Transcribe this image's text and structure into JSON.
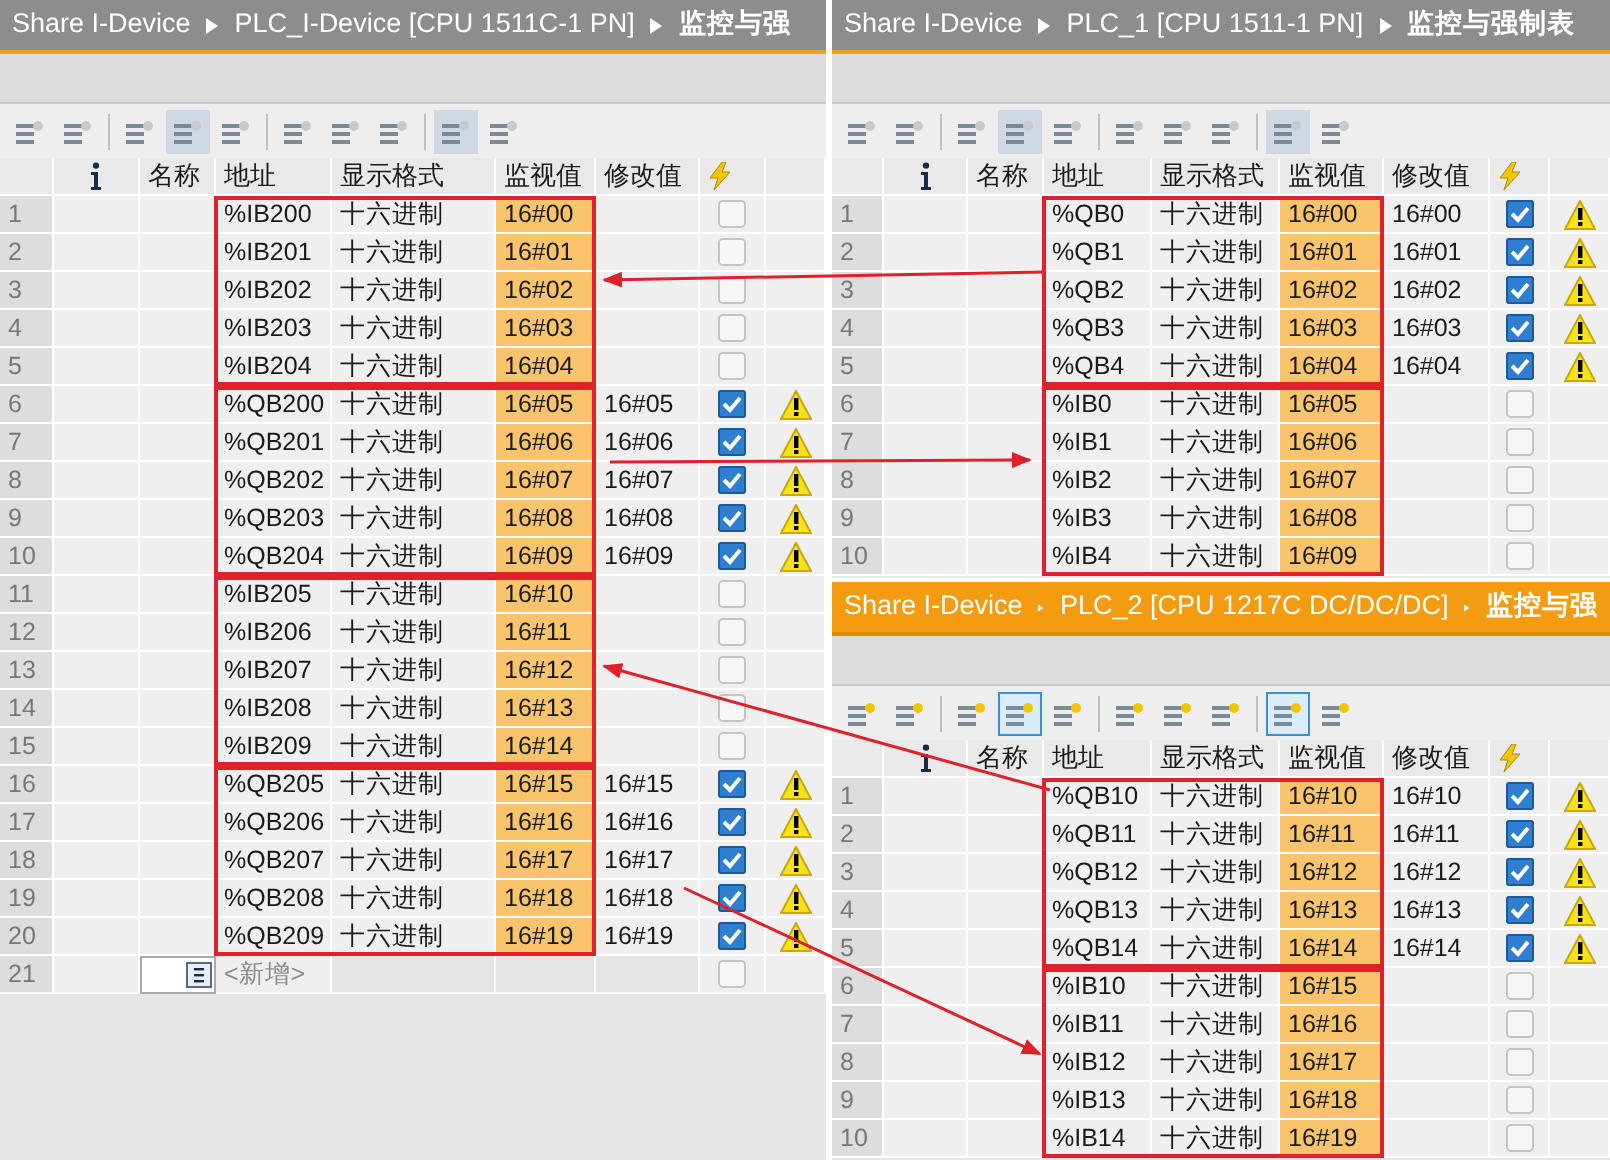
{
  "panels": [
    {
      "breadcrumb": [
        "Share I-Device",
        "PLC_I-Device [CPU 1511C-1 PN]",
        "监控与强"
      ],
      "active": false,
      "columns": [
        "名称",
        "地址",
        "显示格式",
        "监视值",
        "修改值"
      ],
      "groups": [
        {
          "rows": [
            {
              "number": "1",
              "address": "%IB200",
              "format": "十六进制",
              "monitor": "16#00",
              "checked": false,
              "warning": false
            },
            {
              "number": "2",
              "address": "%IB201",
              "format": "十六进制",
              "monitor": "16#01",
              "checked": false,
              "warning": false
            },
            {
              "number": "3",
              "address": "%IB202",
              "format": "十六进制",
              "monitor": "16#02",
              "checked": false,
              "warning": false
            },
            {
              "number": "4",
              "address": "%IB203",
              "format": "十六进制",
              "monitor": "16#03",
              "checked": false,
              "warning": false
            },
            {
              "number": "5",
              "address": "%IB204",
              "format": "十六进制",
              "monitor": "16#04",
              "checked": false,
              "warning": false
            }
          ]
        },
        {
          "rows": [
            {
              "number": "6",
              "address": "%QB200",
              "format": "十六进制",
              "monitor": "16#05",
              "modify": "16#05",
              "checked": true,
              "warning": true
            },
            {
              "number": "7",
              "address": "%QB201",
              "format": "十六进制",
              "monitor": "16#06",
              "modify": "16#06",
              "checked": true,
              "warning": true
            },
            {
              "number": "8",
              "address": "%QB202",
              "format": "十六进制",
              "monitor": "16#07",
              "modify": "16#07",
              "checked": true,
              "warning": true
            },
            {
              "number": "9",
              "address": "%QB203",
              "format": "十六进制",
              "monitor": "16#08",
              "modify": "16#08",
              "checked": true,
              "warning": true
            },
            {
              "number": "10",
              "address": "%QB204",
              "format": "十六进制",
              "monitor": "16#09",
              "modify": "16#09",
              "checked": true,
              "warning": true
            }
          ]
        },
        {
          "rows": [
            {
              "number": "11",
              "address": "%IB205",
              "format": "十六进制",
              "monitor": "16#10",
              "checked": false,
              "warning": false
            },
            {
              "number": "12",
              "address": "%IB206",
              "format": "十六进制",
              "monitor": "16#11",
              "checked": false,
              "warning": false
            },
            {
              "number": "13",
              "address": "%IB207",
              "format": "十六进制",
              "monitor": "16#12",
              "checked": false,
              "warning": false
            },
            {
              "number": "14",
              "address": "%IB208",
              "format": "十六进制",
              "monitor": "16#13",
              "checked": false,
              "warning": false
            },
            {
              "number": "15",
              "address": "%IB209",
              "format": "十六进制",
              "monitor": "16#14",
              "checked": false,
              "warning": false
            }
          ]
        },
        {
          "rows": [
            {
              "number": "16",
              "address": "%QB205",
              "format": "十六进制",
              "monitor": "16#15",
              "modify": "16#15",
              "checked": true,
              "warning": true
            },
            {
              "number": "17",
              "address": "%QB206",
              "format": "十六进制",
              "monitor": "16#16",
              "modify": "16#16",
              "checked": true,
              "warning": true
            },
            {
              "number": "18",
              "address": "%QB207",
              "format": "十六进制",
              "monitor": "16#17",
              "modify": "16#17",
              "checked": true,
              "warning": true
            },
            {
              "number": "19",
              "address": "%QB208",
              "format": "十六进制",
              "monitor": "16#18",
              "modify": "16#18",
              "checked": true,
              "warning": true
            },
            {
              "number": "20",
              "address": "%QB209",
              "format": "十六进制",
              "monitor": "16#19",
              "modify": "16#19",
              "checked": true,
              "warning": true
            }
          ]
        }
      ],
      "new_row": {
        "number": "21",
        "text": "<新增>",
        "checked": false
      }
    },
    {
      "breadcrumb": [
        "Share I-Device",
        "PLC_1 [CPU 1511-1 PN]",
        "监控与强制表"
      ],
      "active": false,
      "columns": [
        "名称",
        "地址",
        "显示格式",
        "监视值",
        "修改值"
      ],
      "groups": [
        {
          "rows": [
            {
              "number": "1",
              "address": "%QB0",
              "format": "十六进制",
              "monitor": "16#00",
              "modify": "16#00",
              "checked": true,
              "warning": true
            },
            {
              "number": "2",
              "address": "%QB1",
              "format": "十六进制",
              "monitor": "16#01",
              "modify": "16#01",
              "checked": true,
              "warning": true
            },
            {
              "number": "3",
              "address": "%QB2",
              "format": "十六进制",
              "monitor": "16#02",
              "modify": "16#02",
              "checked": true,
              "warning": true
            },
            {
              "number": "4",
              "address": "%QB3",
              "format": "十六进制",
              "monitor": "16#03",
              "modify": "16#03",
              "checked": true,
              "warning": true
            },
            {
              "number": "5",
              "address": "%QB4",
              "format": "十六进制",
              "monitor": "16#04",
              "modify": "16#04",
              "checked": true,
              "warning": true
            }
          ]
        },
        {
          "rows": [
            {
              "number": "6",
              "address": "%IB0",
              "format": "十六进制",
              "monitor": "16#05",
              "checked": false,
              "warning": false
            },
            {
              "number": "7",
              "address": "%IB1",
              "format": "十六进制",
              "monitor": "16#06",
              "checked": false,
              "warning": false
            },
            {
              "number": "8",
              "address": "%IB2",
              "format": "十六进制",
              "monitor": "16#07",
              "checked": false,
              "warning": false
            },
            {
              "number": "9",
              "address": "%IB3",
              "format": "十六进制",
              "monitor": "16#08",
              "checked": false,
              "warning": false
            },
            {
              "number": "10",
              "address": "%IB4",
              "format": "十六进制",
              "monitor": "16#09",
              "checked": false,
              "warning": false
            }
          ]
        }
      ]
    },
    {
      "breadcrumb": [
        "Share I-Device",
        "PLC_2 [CPU 1217C DC/DC/DC]",
        "监控与强"
      ],
      "active": true,
      "columns": [
        "名称",
        "地址",
        "显示格式",
        "监视值",
        "修改值"
      ],
      "groups": [
        {
          "rows": [
            {
              "number": "1",
              "address": "%QB10",
              "format": "十六进制",
              "monitor": "16#10",
              "modify": "16#10",
              "checked": true,
              "warning": true
            },
            {
              "number": "2",
              "address": "%QB11",
              "format": "十六进制",
              "monitor": "16#11",
              "modify": "16#11",
              "checked": true,
              "warning": true
            },
            {
              "number": "3",
              "address": "%QB12",
              "format": "十六进制",
              "monitor": "16#12",
              "modify": "16#12",
              "checked": true,
              "warning": true
            },
            {
              "number": "4",
              "address": "%QB13",
              "format": "十六进制",
              "monitor": "16#13",
              "modify": "16#13",
              "checked": true,
              "warning": true
            },
            {
              "number": "5",
              "address": "%QB14",
              "format": "十六进制",
              "monitor": "16#14",
              "modify": "16#14",
              "checked": true,
              "warning": true
            }
          ]
        },
        {
          "rows": [
            {
              "number": "6",
              "address": "%IB10",
              "format": "十六进制",
              "monitor": "16#15",
              "checked": false,
              "warning": false
            },
            {
              "number": "7",
              "address": "%IB11",
              "format": "十六进制",
              "monitor": "16#16",
              "checked": false,
              "warning": false
            },
            {
              "number": "8",
              "address": "%IB12",
              "format": "十六进制",
              "monitor": "16#17",
              "checked": false,
              "warning": false
            },
            {
              "number": "9",
              "address": "%IB13",
              "format": "十六进制",
              "monitor": "16#18",
              "checked": false,
              "warning": false
            },
            {
              "number": "10",
              "address": "%IB14",
              "format": "十六进制",
              "monitor": "16#19",
              "checked": false,
              "warning": false
            }
          ]
        }
      ]
    }
  ]
}
